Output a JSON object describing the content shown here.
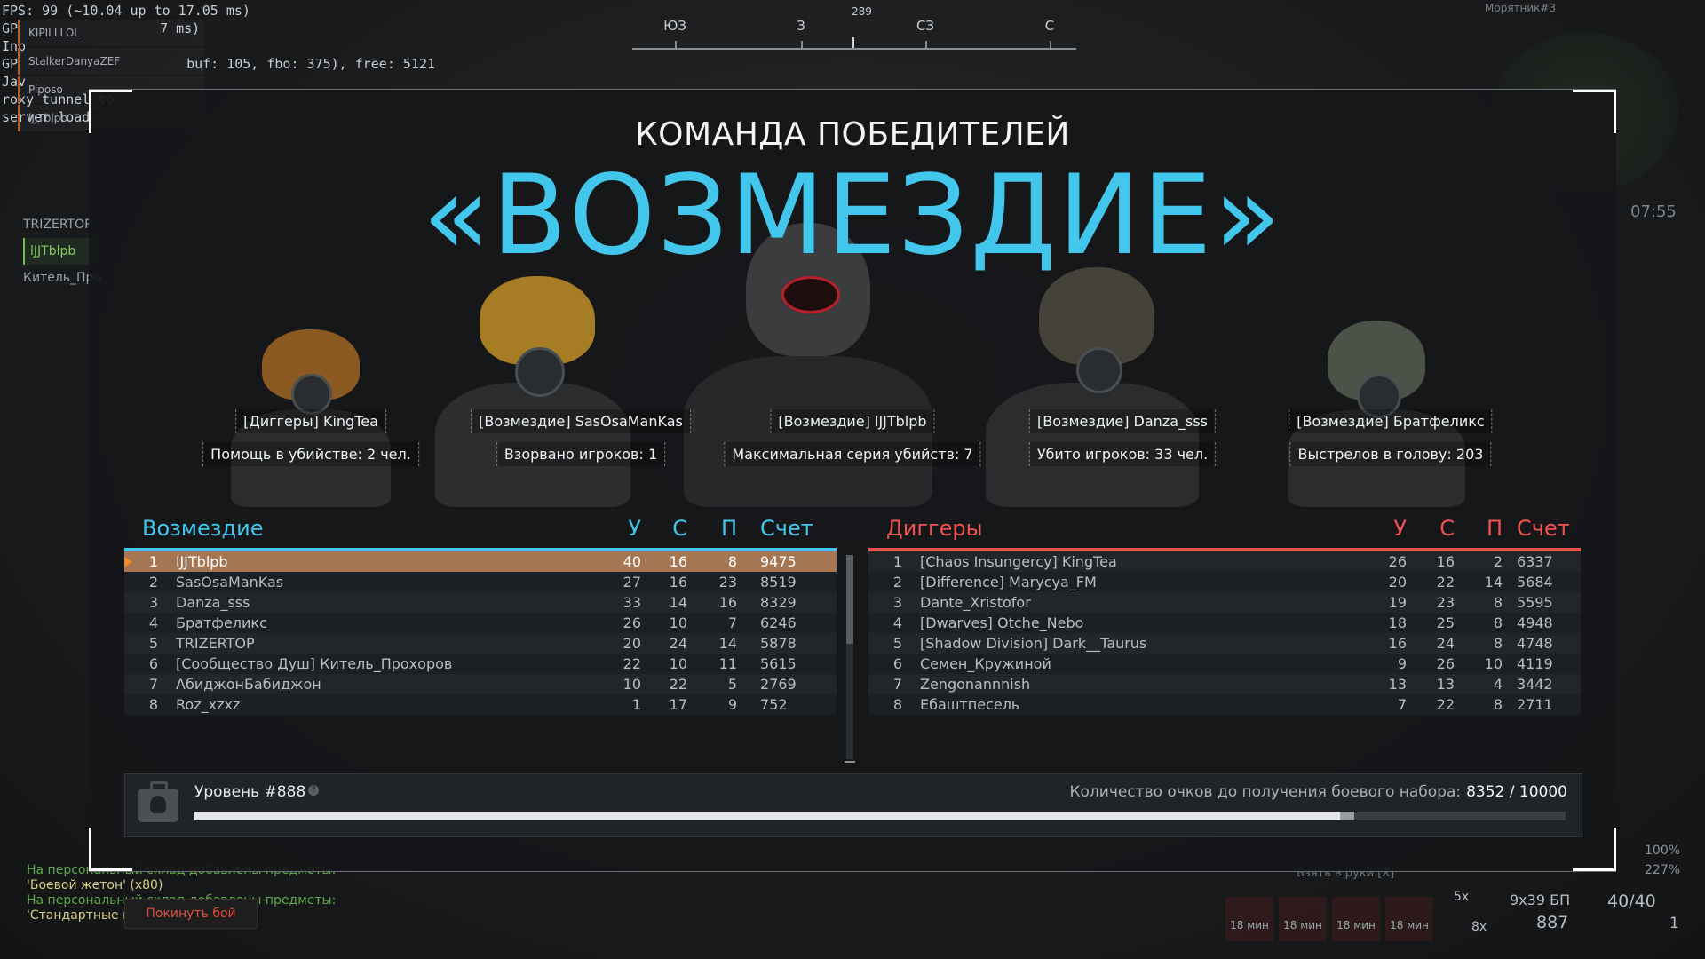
{
  "hud": {
    "fps_line": "FPS: 99 (~10.04 up to 17.05 ms)",
    "gp_line": "GP",
    "gp_tail": "7 ms)",
    "inp_line": "Inp",
    "gp2_line": "GP",
    "buf_line": "buf: 105, fbo: 375), free: 5121",
    "java_line": "Jav",
    "roxy_line": "roxy_tunnel_to",
    "server_line": "server load",
    "party": [
      "KIPILLLOL",
      "StalkerDanyaZEF",
      "Piposo",
      "lJJTblpb"
    ],
    "side_names": [
      "TRIZERTOP",
      "lJJTblpb",
      "Китель_Про"
    ],
    "compass": {
      "degree": "289",
      "labels": [
        "ЮЗ",
        "З",
        "СЗ",
        "С"
      ]
    },
    "minimap_name": "Морятник#3",
    "timer": "07:55",
    "messages": [
      "На персональный склад добавлены предметы:",
      "'Боевой жетон' (x80)",
      "На персональный склад добавлены предметы:",
      "'Стандартные и"
    ],
    "leave_button": "Покинуть бой",
    "take_hint": "Взять в руки [X]",
    "slots": [
      "18 мин",
      "18 мин",
      "18 мин",
      "18 мин"
    ],
    "caliber": "9x39 БП",
    "ammo_mag": "40/40",
    "ammo_total": "887",
    "ammo_extra": "1",
    "mult_top": "5x",
    "mult_bottom": "8x",
    "pct_top": "100%",
    "pct_bottom": "227%"
  },
  "result": {
    "subtitle": "КОМАНДА ПОБЕДИТЕЛЕЙ",
    "team_name": "«ВОЗМЕЗДИЕ»",
    "highlights": [
      {
        "name": "[Диггеры] KingTea",
        "stat": "Помощь в убийстве: 2 чел."
      },
      {
        "name": "[Возмездие] SasOsaManKas",
        "stat": "Взорвано игроков: 1"
      },
      {
        "name": "[Возмездие] lJJTblpb",
        "stat": "Максимальная серия убийств: 7"
      },
      {
        "name": "[Возмездие] Danza_sss",
        "stat": "Убито игроков: 33 чел."
      },
      {
        "name": "[Возмездие] Братфеликс",
        "stat": "Выстрелов в голову: 203"
      }
    ],
    "columns": [
      "У",
      "С",
      "П",
      "Счет"
    ],
    "left_team": {
      "name": "Возмездие",
      "rows": [
        {
          "rank": "1",
          "player": "lJJTblpb",
          "k": "40",
          "d": "16",
          "a": "8",
          "score": "9475"
        },
        {
          "rank": "2",
          "player": "SasOsaManKas",
          "k": "27",
          "d": "16",
          "a": "23",
          "score": "8519"
        },
        {
          "rank": "3",
          "player": "Danza_sss",
          "k": "33",
          "d": "14",
          "a": "16",
          "score": "8329"
        },
        {
          "rank": "4",
          "player": "Братфеликс",
          "k": "26",
          "d": "10",
          "a": "7",
          "score": "6246"
        },
        {
          "rank": "5",
          "player": "TRIZERTOP",
          "k": "20",
          "d": "24",
          "a": "14",
          "score": "5878"
        },
        {
          "rank": "6",
          "player": "[Сообщество Душ] Китель_Прохоров",
          "k": "22",
          "d": "10",
          "a": "11",
          "score": "5615"
        },
        {
          "rank": "7",
          "player": "АбиджонБабиджон",
          "k": "10",
          "d": "22",
          "a": "5",
          "score": "2769"
        },
        {
          "rank": "8",
          "player": "Roz_xzxz",
          "k": "1",
          "d": "17",
          "a": "9",
          "score": "752"
        }
      ]
    },
    "right_team": {
      "name": "Диггеры",
      "rows": [
        {
          "rank": "1",
          "player": "[Chaos Insungercy] KingTea",
          "k": "26",
          "d": "16",
          "a": "2",
          "score": "6337"
        },
        {
          "rank": "2",
          "player": "[Difference] Marycya_FM",
          "k": "20",
          "d": "22",
          "a": "14",
          "score": "5684"
        },
        {
          "rank": "3",
          "player": "Dante_Xristofor",
          "k": "19",
          "d": "23",
          "a": "8",
          "score": "5595"
        },
        {
          "rank": "4",
          "player": "[Dwarves] Otche_Nebo",
          "k": "18",
          "d": "25",
          "a": "8",
          "score": "4948"
        },
        {
          "rank": "5",
          "player": "[Shadow Division] Dark__Taurus",
          "k": "16",
          "d": "24",
          "a": "8",
          "score": "4748"
        },
        {
          "rank": "6",
          "player": "Семен_Кружиной",
          "k": "9",
          "d": "26",
          "a": "10",
          "score": "4119"
        },
        {
          "rank": "7",
          "player": "Zengonannnish",
          "k": "13",
          "d": "13",
          "a": "4",
          "score": "3442"
        },
        {
          "rank": "8",
          "player": "Ебаштпесель",
          "k": "7",
          "d": "22",
          "a": "8",
          "score": "2711"
        }
      ]
    },
    "level": {
      "label": "Уровень #888",
      "need_label": "Количество очков до получения боевого набора:",
      "progress_text": "8352 / 10000",
      "progress_fraction": 0.8352
    }
  },
  "colors": {
    "friendly": "#42c6ec",
    "enemy": "#f05252",
    "self_row": "#a47654"
  }
}
